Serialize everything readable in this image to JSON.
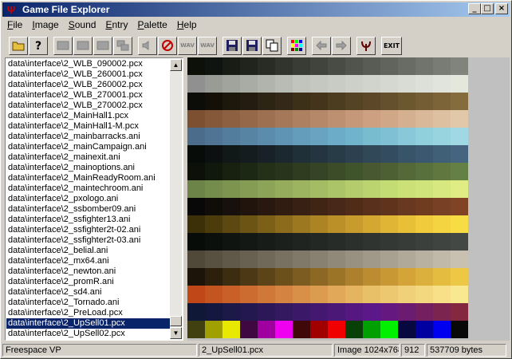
{
  "window": {
    "title": "Game File Explorer"
  },
  "menu": [
    {
      "label": "File",
      "u": "F",
      "rest": "ile"
    },
    {
      "label": "Image",
      "u": "I",
      "rest": "mage"
    },
    {
      "label": "Sound",
      "u": "S",
      "rest": "ound"
    },
    {
      "label": "Entry",
      "u": "E",
      "rest": "ntry"
    },
    {
      "label": "Palette",
      "u": "P",
      "rest": "alette"
    },
    {
      "label": "Help",
      "u": "H",
      "rest": "elp"
    }
  ],
  "toolbar": {
    "wav1": "WAV",
    "wav2": "WAV",
    "exit": "EXIT"
  },
  "files": [
    "data\\interface\\2_WLB_090002.pcx",
    "data\\interface\\2_WLB_260001.pcx",
    "data\\interface\\2_WLB_260002.pcx",
    "data\\interface\\2_WLB_270001.pcx",
    "data\\interface\\2_WLB_270002.pcx",
    "data\\interface\\2_MainHall1.pcx",
    "data\\interface\\2_MainHall1-M.pcx",
    "data\\interface\\2_mainbarracks.ani",
    "data\\interface\\2_mainCampaign.ani",
    "data\\interface\\2_mainexit.ani",
    "data\\interface\\2_mainoptions.ani",
    "data\\interface\\2_MainReadyRoom.ani",
    "data\\interface\\2_maintechroom.ani",
    "data\\interface\\2_pxologo.ani",
    "data\\interface\\2_ssbomber09.ani",
    "data\\interface\\2_ssfighter13.ani",
    "data\\interface\\2_ssfighter2t-02.ani",
    "data\\interface\\2_ssfighter2t-03.ani",
    "data\\interface\\2_belial.ani",
    "data\\interface\\2_mx64.ani",
    "data\\interface\\2_newton.ani",
    "data\\interface\\2_promR.ani",
    "data\\interface\\2_sd4.ani",
    "data\\interface\\2_Tornado.ani",
    "data\\interface\\2_PreLoad.pcx",
    "data\\interface\\2_UpSell01.pcx",
    "data\\interface\\2_UpSell02.pcx"
  ],
  "selected_index": 25,
  "palette_rows": [
    [
      "#0c1008",
      "#101410",
      "#181c14",
      "#20241c",
      "#282c24",
      "#30342c",
      "#383c34",
      "#40443c",
      "#484c44",
      "#50544c",
      "#585c54",
      "#60645c",
      "#686c64",
      "#70746c",
      "#787c74",
      "#80847c"
    ],
    [
      "#909090",
      "#989c94",
      "#a0a49c",
      "#a8aca4",
      "#b0b4ac",
      "#b8bcb4",
      "#c0c4bc",
      "#c4c8c0",
      "#c8ccc4",
      "#ccd0c8",
      "#d0d4cc",
      "#d4d8d0",
      "#d8dcd4",
      "#dce0d8",
      "#e0e4dc",
      "#e4e8dc"
    ],
    [
      "#0c0c08",
      "#141008",
      "#1c180c",
      "#241c10",
      "#2c2414",
      "#342818",
      "#3c3018",
      "#44341c",
      "#4c3c20",
      "#544424",
      "#5c4828",
      "#64502c",
      "#6c5830",
      "#745c34",
      "#7c6438",
      "#846c3c"
    ],
    [
      "#7c5030",
      "#845838",
      "#8c6040",
      "#946848",
      "#9c7050",
      "#a47858",
      "#ac8060",
      "#b48868",
      "#bc9070",
      "#c49878",
      "#cca080",
      "#d0a888",
      "#d4b090",
      "#d8b898",
      "#dcc0a0",
      "#e0c8a8"
    ],
    [
      "#4c6c8c",
      "#507494",
      "#547c9c",
      "#5884a4",
      "#5c8cac",
      "#6094b4",
      "#649cbc",
      "#68a4c0",
      "#6cacc8",
      "#70b4cc",
      "#78bcd0",
      "#80c0d4",
      "#88c8d8",
      "#90d0dc",
      "#98d4e0",
      "#a0d8e4"
    ],
    [
      "#080c08",
      "#0c1010",
      "#101818",
      "#141c20",
      "#182028",
      "#1c2830",
      "#203038",
      "#243440",
      "#283c48",
      "#2c4050",
      "#304858",
      "#344c60",
      "#385468",
      "#3c5870",
      "#406078",
      "#446480"
    ],
    [
      "#0c1008",
      "#10180c",
      "#182010",
      "#1c2814",
      "#243018",
      "#28341c",
      "#303c20",
      "#344424",
      "#3c4c28",
      "#40542c",
      "#485830",
      "#4c6034",
      "#546838",
      "#58703c",
      "#607840",
      "#648044"
    ],
    [
      "#6c8448",
      "#748c4c",
      "#7c9450",
      "#849c54",
      "#8ca458",
      "#94ac5c",
      "#9cb460",
      "#a4bc64",
      "#acc468",
      "#b4cc6c",
      "#bcd470",
      "#c4dc74",
      "#cce078",
      "#d0e47c",
      "#d8e880",
      "#e0ec84"
    ],
    [
      "#080808",
      "#100c08",
      "#18100c",
      "#20140c",
      "#281810",
      "#301c10",
      "#382014",
      "#402414",
      "#482818",
      "#502c18",
      "#58301c",
      "#60341c",
      "#683820",
      "#703c20",
      "#784024",
      "#804424"
    ],
    [
      "#3c3008",
      "#4c3c0c",
      "#5c4810",
      "#6c5414",
      "#7c6018",
      "#8c6c1c",
      "#9c7820",
      "#ac8424",
      "#bc9028",
      "#c89c2c",
      "#d4a830",
      "#e0b434",
      "#e8c038",
      "#f0cc3c",
      "#f4d440",
      "#f8dc44"
    ],
    [
      "#080c08",
      "#0c100c",
      "#101410",
      "#141814",
      "#181c18",
      "#1c201c",
      "#202420",
      "#242824",
      "#282c28",
      "#2c302c",
      "#303430",
      "#343834",
      "#383c38",
      "#3c403c",
      "#404440",
      "#444844"
    ],
    [
      "#504838",
      "#585040",
      "#605848",
      "#686050",
      "#706858",
      "#787060",
      "#807868",
      "#888070",
      "#908878",
      "#989080",
      "#a09888",
      "#a8a090",
      "#b0a898",
      "#b8b0a0",
      "#c0b8a8",
      "#c8c0b0"
    ],
    [
      "#1c1408",
      "#2c200c",
      "#3c2c10",
      "#4c3814",
      "#5c4418",
      "#6c501c",
      "#7c5c20",
      "#8c6824",
      "#9c7428",
      "#ac802c",
      "#bc8c30",
      "#c89834",
      "#d4a438",
      "#dcb03c",
      "#e4bc40",
      "#ecc844"
    ],
    [
      "#c04818",
      "#c45420",
      "#c86028",
      "#cc6c30",
      "#d07838",
      "#d48440",
      "#d89048",
      "#dc9c50",
      "#e0a858",
      "#e4b460",
      "#e8c068",
      "#ecc870",
      "#f0d078",
      "#f4d880",
      "#f8e088",
      "#f8e890"
    ],
    [
      "#101838",
      "#141840",
      "#1c1848",
      "#241850",
      "#2c1858",
      "#341860",
      "#3c1868",
      "#441870",
      "#4c1878",
      "#541880",
      "#5c1888",
      "#641880",
      "#6c1c70",
      "#742060",
      "#7c2450",
      "#842840"
    ],
    [
      "#404010",
      "#a0a000",
      "#e8e800",
      "#400840",
      "#a000a0",
      "#f000f0",
      "#400808",
      "#a00000",
      "#f00000",
      "#084008",
      "#00a000",
      "#00f000",
      "#080840",
      "#0000a0",
      "#0000f0",
      "#080808"
    ]
  ],
  "status": {
    "source": "Freespace VP",
    "file": "2_UpSell01.pcx",
    "image": "Image 1024x768",
    "index": "912",
    "size": "537709 bytes"
  }
}
